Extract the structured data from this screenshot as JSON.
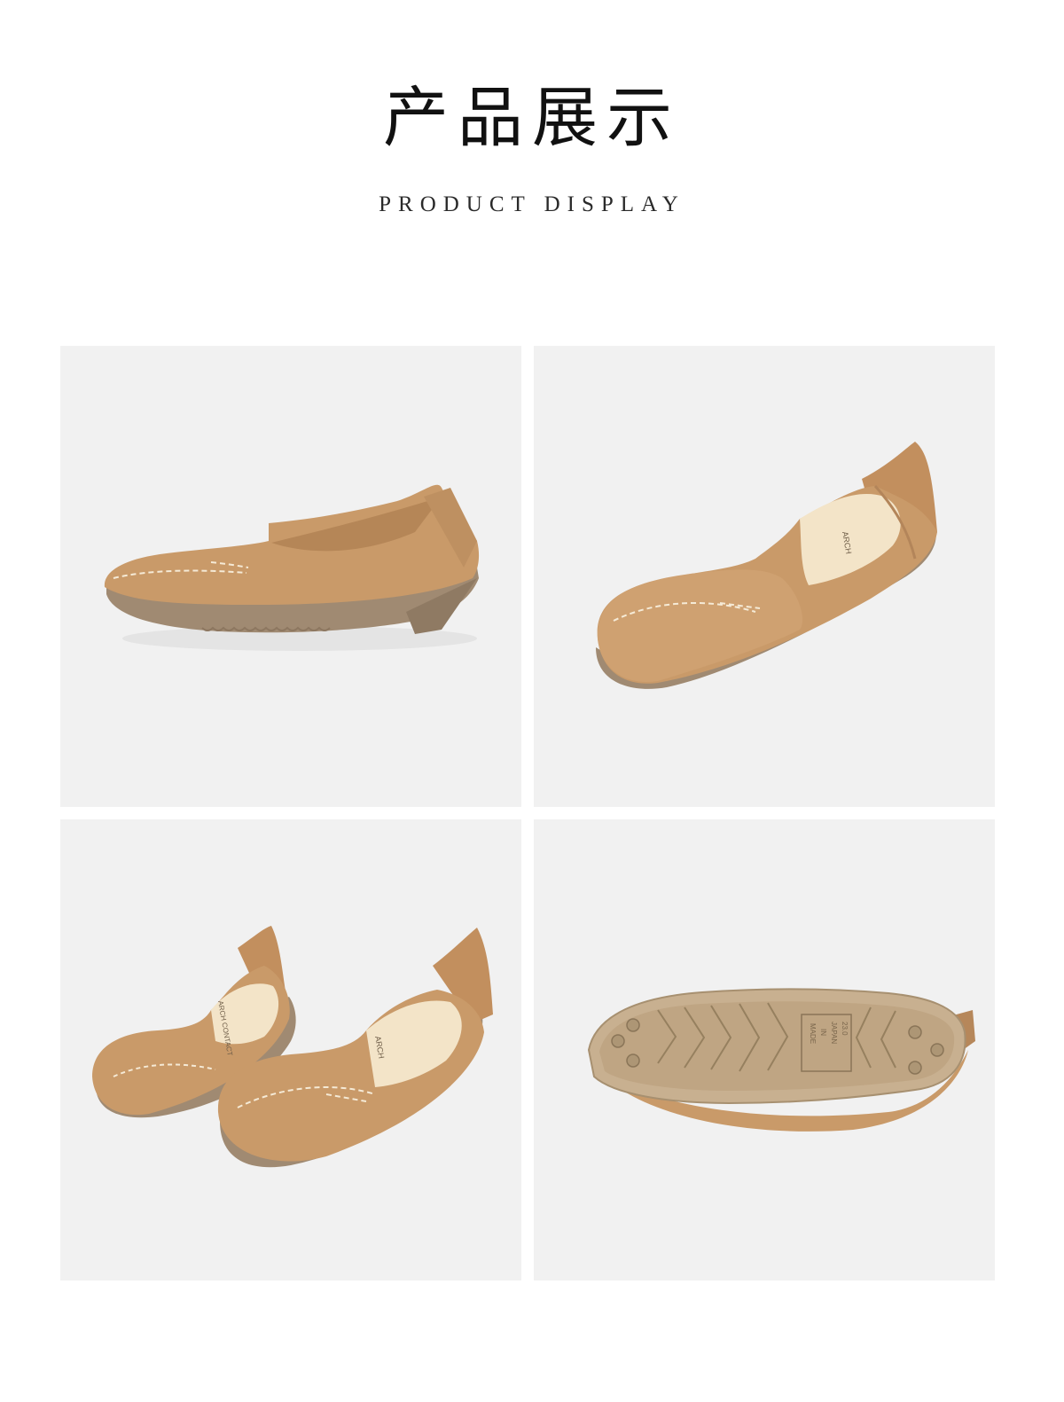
{
  "header": {
    "title_cn": "产品展示",
    "title_en": "PRODUCT DISPLAY"
  },
  "colors": {
    "background": "#ffffff",
    "panel_background": "#f1f1f1",
    "shoe_upper": "#c99a69",
    "shoe_shadow": "#b6875a",
    "sole": "#a08a72",
    "insole": "#f3e4c8",
    "stitch": "#f5ead6"
  },
  "gallery": {
    "items": [
      {
        "view": "side-view",
        "icon": "loafer-side-icon"
      },
      {
        "view": "front-three-quarter-view",
        "icon": "loafer-front-icon"
      },
      {
        "view": "pair-view",
        "icon": "loafer-pair-icon",
        "insole_brand": "ARCH CONTACT"
      },
      {
        "view": "sole-view",
        "icon": "loafer-sole-icon",
        "sole_marking": [
          "MADE",
          "IN",
          "JAPAN",
          "23.0"
        ]
      }
    ]
  }
}
